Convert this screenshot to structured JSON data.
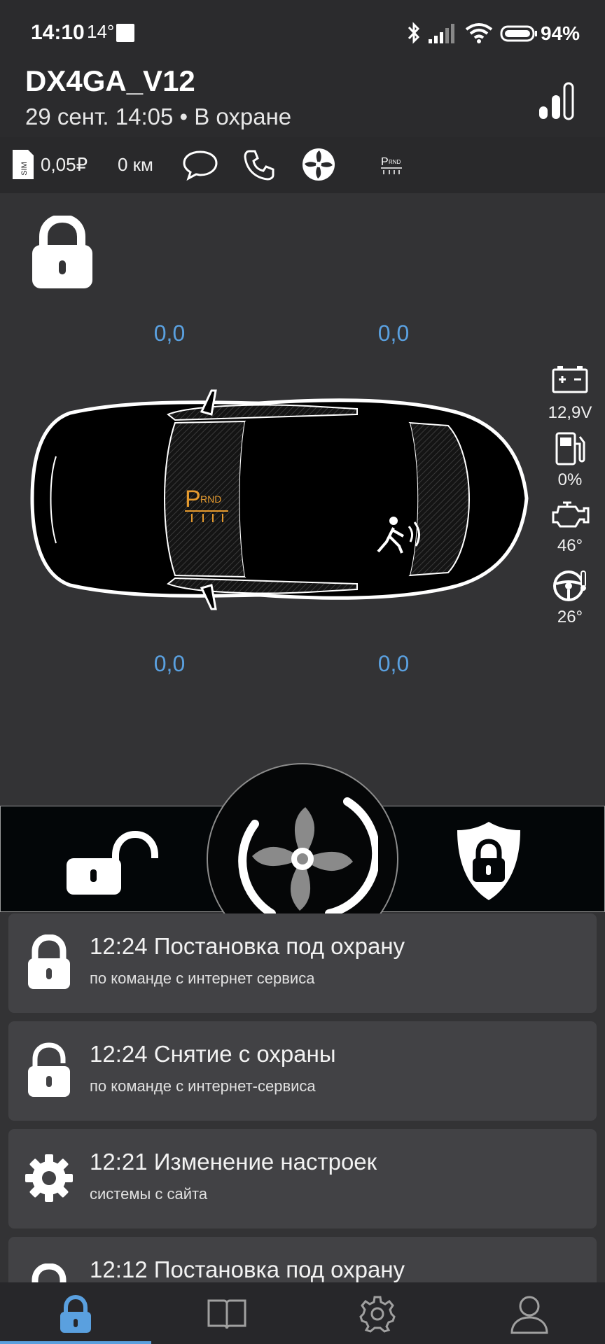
{
  "status_bar": {
    "time": "14:10",
    "temperature": "14°",
    "battery": "94%"
  },
  "header": {
    "device_name": "DX4GA_V12",
    "status_line": "29 сент. 14:05 • В охране"
  },
  "info_bar": {
    "balance": "0,05₽",
    "mileage": "0 км"
  },
  "tire_pressure": {
    "front_left": "0,0",
    "front_right": "0,0",
    "rear_left": "0,0",
    "rear_right": "0,0"
  },
  "gauges": {
    "battery_voltage": "12,9V",
    "fuel": "0%",
    "engine_temp": "46°",
    "cabin_temp": "26°"
  },
  "car": {
    "gear": "P",
    "gear_rest": "RND"
  },
  "events": [
    {
      "title": "12:24 Постановка под охрану",
      "desc": "по команде с интернет сервиса",
      "icon": "lock-closed-icon"
    },
    {
      "title": "12:24 Снятие с охраны",
      "desc": "по команде с интернет-сервиса",
      "icon": "lock-open-icon"
    },
    {
      "title": "12:21 Изменение настроек",
      "desc": "системы с сайта",
      "icon": "gear-icon"
    },
    {
      "title": "12:12 Постановка под охрану",
      "desc": "",
      "icon": "lock-closed-icon"
    }
  ],
  "colors": {
    "accent": "#5aa0df",
    "background": "#333335",
    "card": "#424245",
    "gear_orange": "#e59a2e"
  }
}
